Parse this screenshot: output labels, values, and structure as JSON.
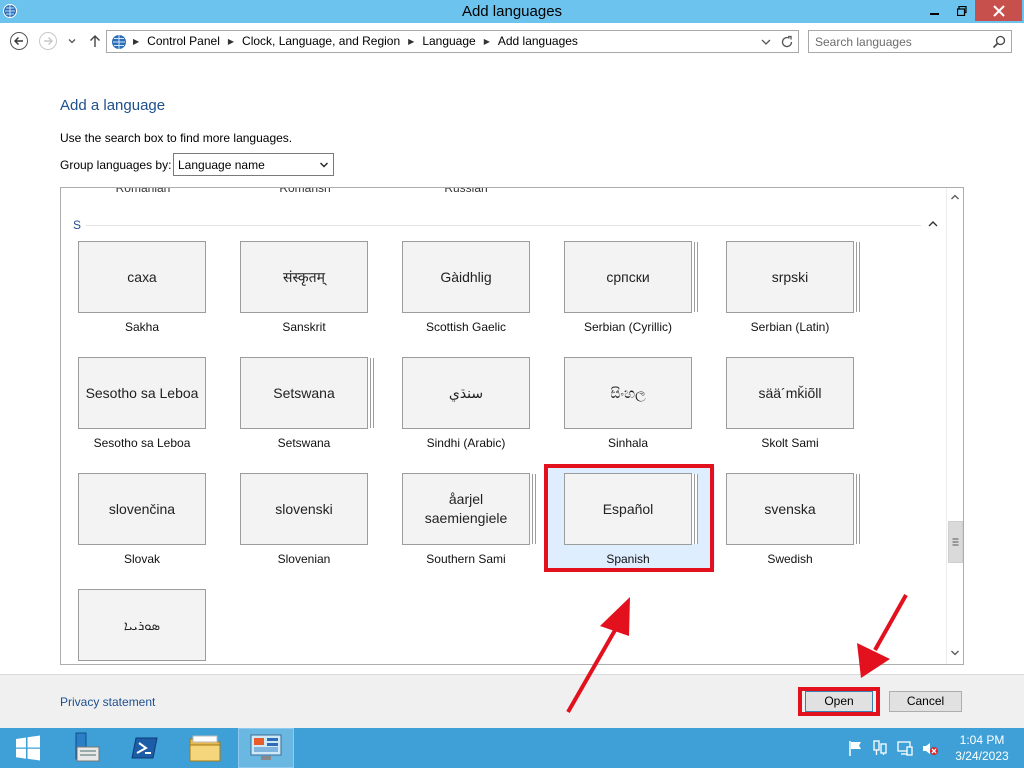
{
  "window": {
    "title": "Add languages",
    "app_icon": "control-panel-icon",
    "controls": [
      "minimize-icon",
      "restore-icon",
      "close-icon"
    ]
  },
  "navigation": {
    "breadcrumbs": [
      "Control Panel",
      "Clock, Language, and Region",
      "Language",
      "Add languages"
    ],
    "search_placeholder": "Search languages"
  },
  "page": {
    "heading": "Add a language",
    "hint": "Use the search box to find more languages.",
    "group_label": "Group languages by:",
    "group_value": "Language name",
    "previous_row": [
      "Romanian",
      "Romansh",
      "Russian"
    ],
    "section_letter": "S",
    "selected_language": "Spanish",
    "languages": [
      {
        "native": "саха",
        "name": "Sakha"
      },
      {
        "native": "संस्कृतम्",
        "name": "Sanskrit"
      },
      {
        "native": "Gàidhlig",
        "name": "Scottish Gaelic"
      },
      {
        "native": "српски",
        "name": "Serbian (Cyrillic)"
      },
      {
        "native": "srpski",
        "name": "Serbian (Latin)"
      },
      {
        "native": "Sesotho sa Leboa",
        "name": "Sesotho sa Leboa"
      },
      {
        "native": "Setswana",
        "name": "Setswana"
      },
      {
        "native": "سنڌي",
        "name": "Sindhi (Arabic)"
      },
      {
        "native": "සිංහල",
        "name": "Sinhala"
      },
      {
        "native": "sää´mǩiõll",
        "name": "Skolt Sami"
      },
      {
        "native": "slovenčina",
        "name": "Slovak"
      },
      {
        "native": "slovenski",
        "name": "Slovenian"
      },
      {
        "native": "åarjel saemiengiele",
        "name": "Southern Sami"
      },
      {
        "native": "Español",
        "name": "Spanish"
      },
      {
        "native": "svenska",
        "name": "Swedish"
      },
      {
        "native": "ܣܘܪܝܝܐ",
        "name": ""
      }
    ]
  },
  "footer": {
    "privacy": "Privacy statement",
    "open": "Open",
    "cancel": "Cancel"
  },
  "taskbar": {
    "items": [
      "windows-start-icon",
      "server-manager-icon",
      "powershell-icon",
      "file-explorer-icon",
      "control-panel-icon"
    ],
    "tray": [
      "flag-icon",
      "network-icon",
      "devices-icon",
      "volume-muted-icon"
    ],
    "time": "1:04 PM",
    "date": "3/24/2023"
  },
  "annotations": {
    "color": "#e3101d"
  }
}
